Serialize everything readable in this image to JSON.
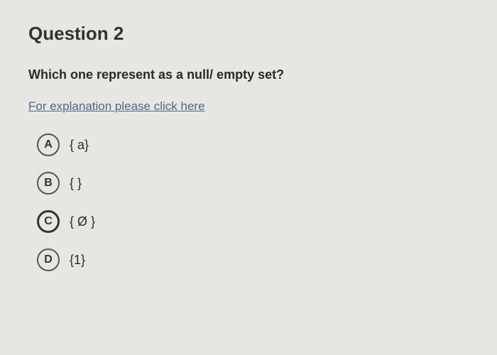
{
  "question": {
    "title": "Question 2",
    "prompt": "Which one represent as a null/ empty set?",
    "explanation_link": "For explanation please click here",
    "options": [
      {
        "letter": "A",
        "text": "{ a}"
      },
      {
        "letter": "B",
        "text": "{ }"
      },
      {
        "letter": "C",
        "text": "{  Ø  }"
      },
      {
        "letter": "D",
        "text": "{1}"
      }
    ],
    "selected_index": 2
  }
}
